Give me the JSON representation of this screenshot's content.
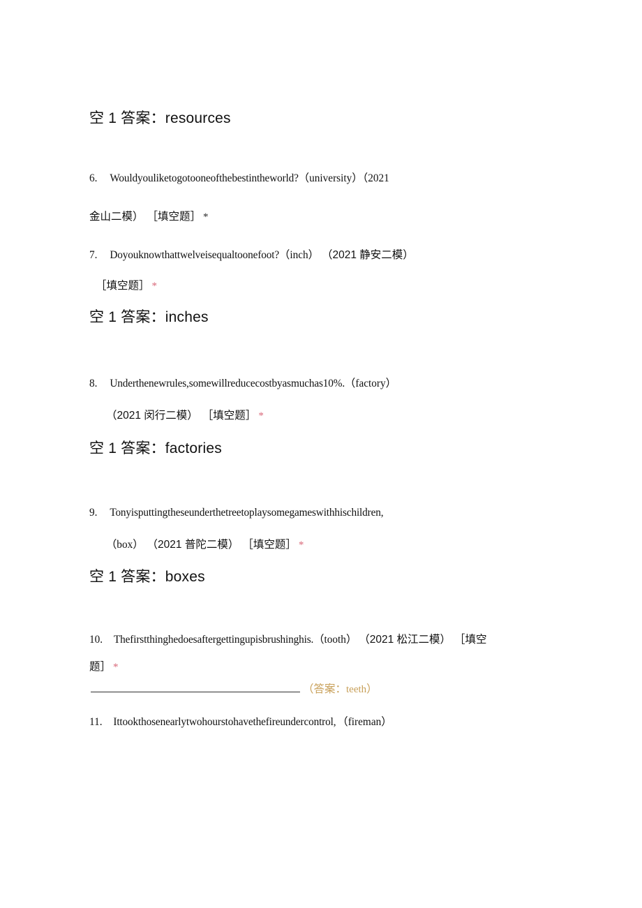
{
  "document": {
    "page_background": "#ffffff",
    "accent_required_marker_color": "#d9697a",
    "inline_answer_color": "#c8a05a"
  },
  "answers": {
    "resources": {
      "label": "空 1 答案：",
      "value": "resources",
      "full": "空 1 答案：resources"
    },
    "inches": {
      "label": "空 1 答案：",
      "value": "inches",
      "full": "空 1 答案：inches"
    },
    "factories": {
      "label": "空 1 答案：",
      "value": "factories",
      "full": "空 1 答案：factories"
    },
    "boxes": {
      "label": "空 1 答案：",
      "value": "boxes",
      "full": "空 1 答案：boxes"
    }
  },
  "questions": [
    {
      "number": "6.",
      "line1_en": "Wouldyouliketogotooneofthebestintheworld?",
      "hint": "（university）",
      "source_head": "（2021",
      "source_tail": "金山二模）",
      "type_tag": "［填空题］",
      "required_marker": "*",
      "marker_style": "dark"
    },
    {
      "number": "7.",
      "line1_en": "Doyouknowthattwelveisequaltoonefoot?",
      "hint": "（inch）",
      "source": "（2021 静安二模）",
      "type_tag": "［填空题］",
      "required_marker": "*",
      "marker_style": "red"
    },
    {
      "number": "8.",
      "line1_en": "Underthenewrules,somewillreducecostbyasmuchas10%.",
      "hint": "（factory）",
      "source": "（2021 闵行二模）",
      "type_tag": "［填空题］",
      "required_marker": "*",
      "marker_style": "red"
    },
    {
      "number": "9.",
      "line1_en": "Tonyisputtingtheseunderthetreetoplaysomegameswithhischildren,",
      "hint": "（box）",
      "source": "（2021 普陀二模）",
      "type_tag": "［填空题］",
      "required_marker": "*",
      "marker_style": "red"
    },
    {
      "number": "10.",
      "line1_en": "Thefirstthinghedoesaftergettingupisbrushinghis.",
      "hint": "（tooth）",
      "source": "（2021 松江二模）",
      "type_tag_part1": "［填空",
      "type_tag_part2": "题］",
      "required_marker": "*",
      "marker_style": "red",
      "blank_placeholder": "",
      "inline_answer_prefix": "（答案：",
      "inline_answer_value": "teeth",
      "inline_answer_suffix": "）"
    },
    {
      "number": "11.",
      "line1_en": "Ittookthosenearlytwohourstohavethefireundercontrol,",
      "hint": "（fireman）"
    }
  ]
}
